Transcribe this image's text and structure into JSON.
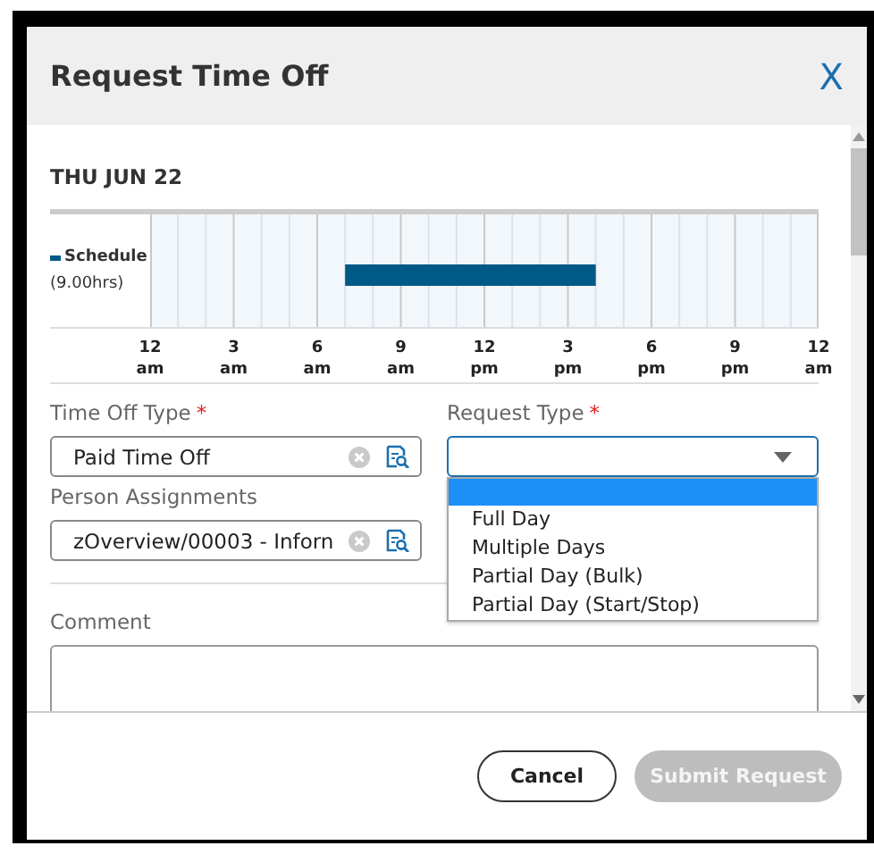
{
  "dialog": {
    "title": "Request Time Off",
    "close": "X"
  },
  "schedule": {
    "date": "THU JUN 22",
    "legend": "Schedule",
    "hours": "(9.00hrs)",
    "color": "#005a85",
    "ticks": [
      {
        "hour": "12",
        "period": "am"
      },
      {
        "hour": "3",
        "period": "am"
      },
      {
        "hour": "6",
        "period": "am"
      },
      {
        "hour": "9",
        "period": "am"
      },
      {
        "hour": "12",
        "period": "pm"
      },
      {
        "hour": "3",
        "period": "pm"
      },
      {
        "hour": "6",
        "period": "pm"
      },
      {
        "hour": "9",
        "period": "pm"
      },
      {
        "hour": "12",
        "period": "am"
      }
    ]
  },
  "form": {
    "time_off_type": {
      "label": "Time Off Type",
      "required_mark": "*",
      "value": "Paid Time Off"
    },
    "request_type": {
      "label": "Request Type",
      "required_mark": "*",
      "expanded": true,
      "blank_option": {
        "selected": true
      },
      "options": [
        {
          "label": "Full Day",
          "selected": false
        },
        {
          "label": "Multiple Days",
          "selected": false
        },
        {
          "label": "Partial Day (Bulk)",
          "selected": false
        },
        {
          "label": "Partial Day (Start/Stop)",
          "selected": false
        }
      ]
    },
    "person_assignments": {
      "label": "Person Assignments",
      "value": "zOverview/00003 - Inforn"
    },
    "comment": {
      "label": "Comment"
    }
  },
  "buttons": [
    {
      "label": "Cancel",
      "kind": "secondary",
      "disabled": false
    },
    {
      "label": "Submit Request",
      "kind": "primary",
      "disabled": true
    }
  ]
}
